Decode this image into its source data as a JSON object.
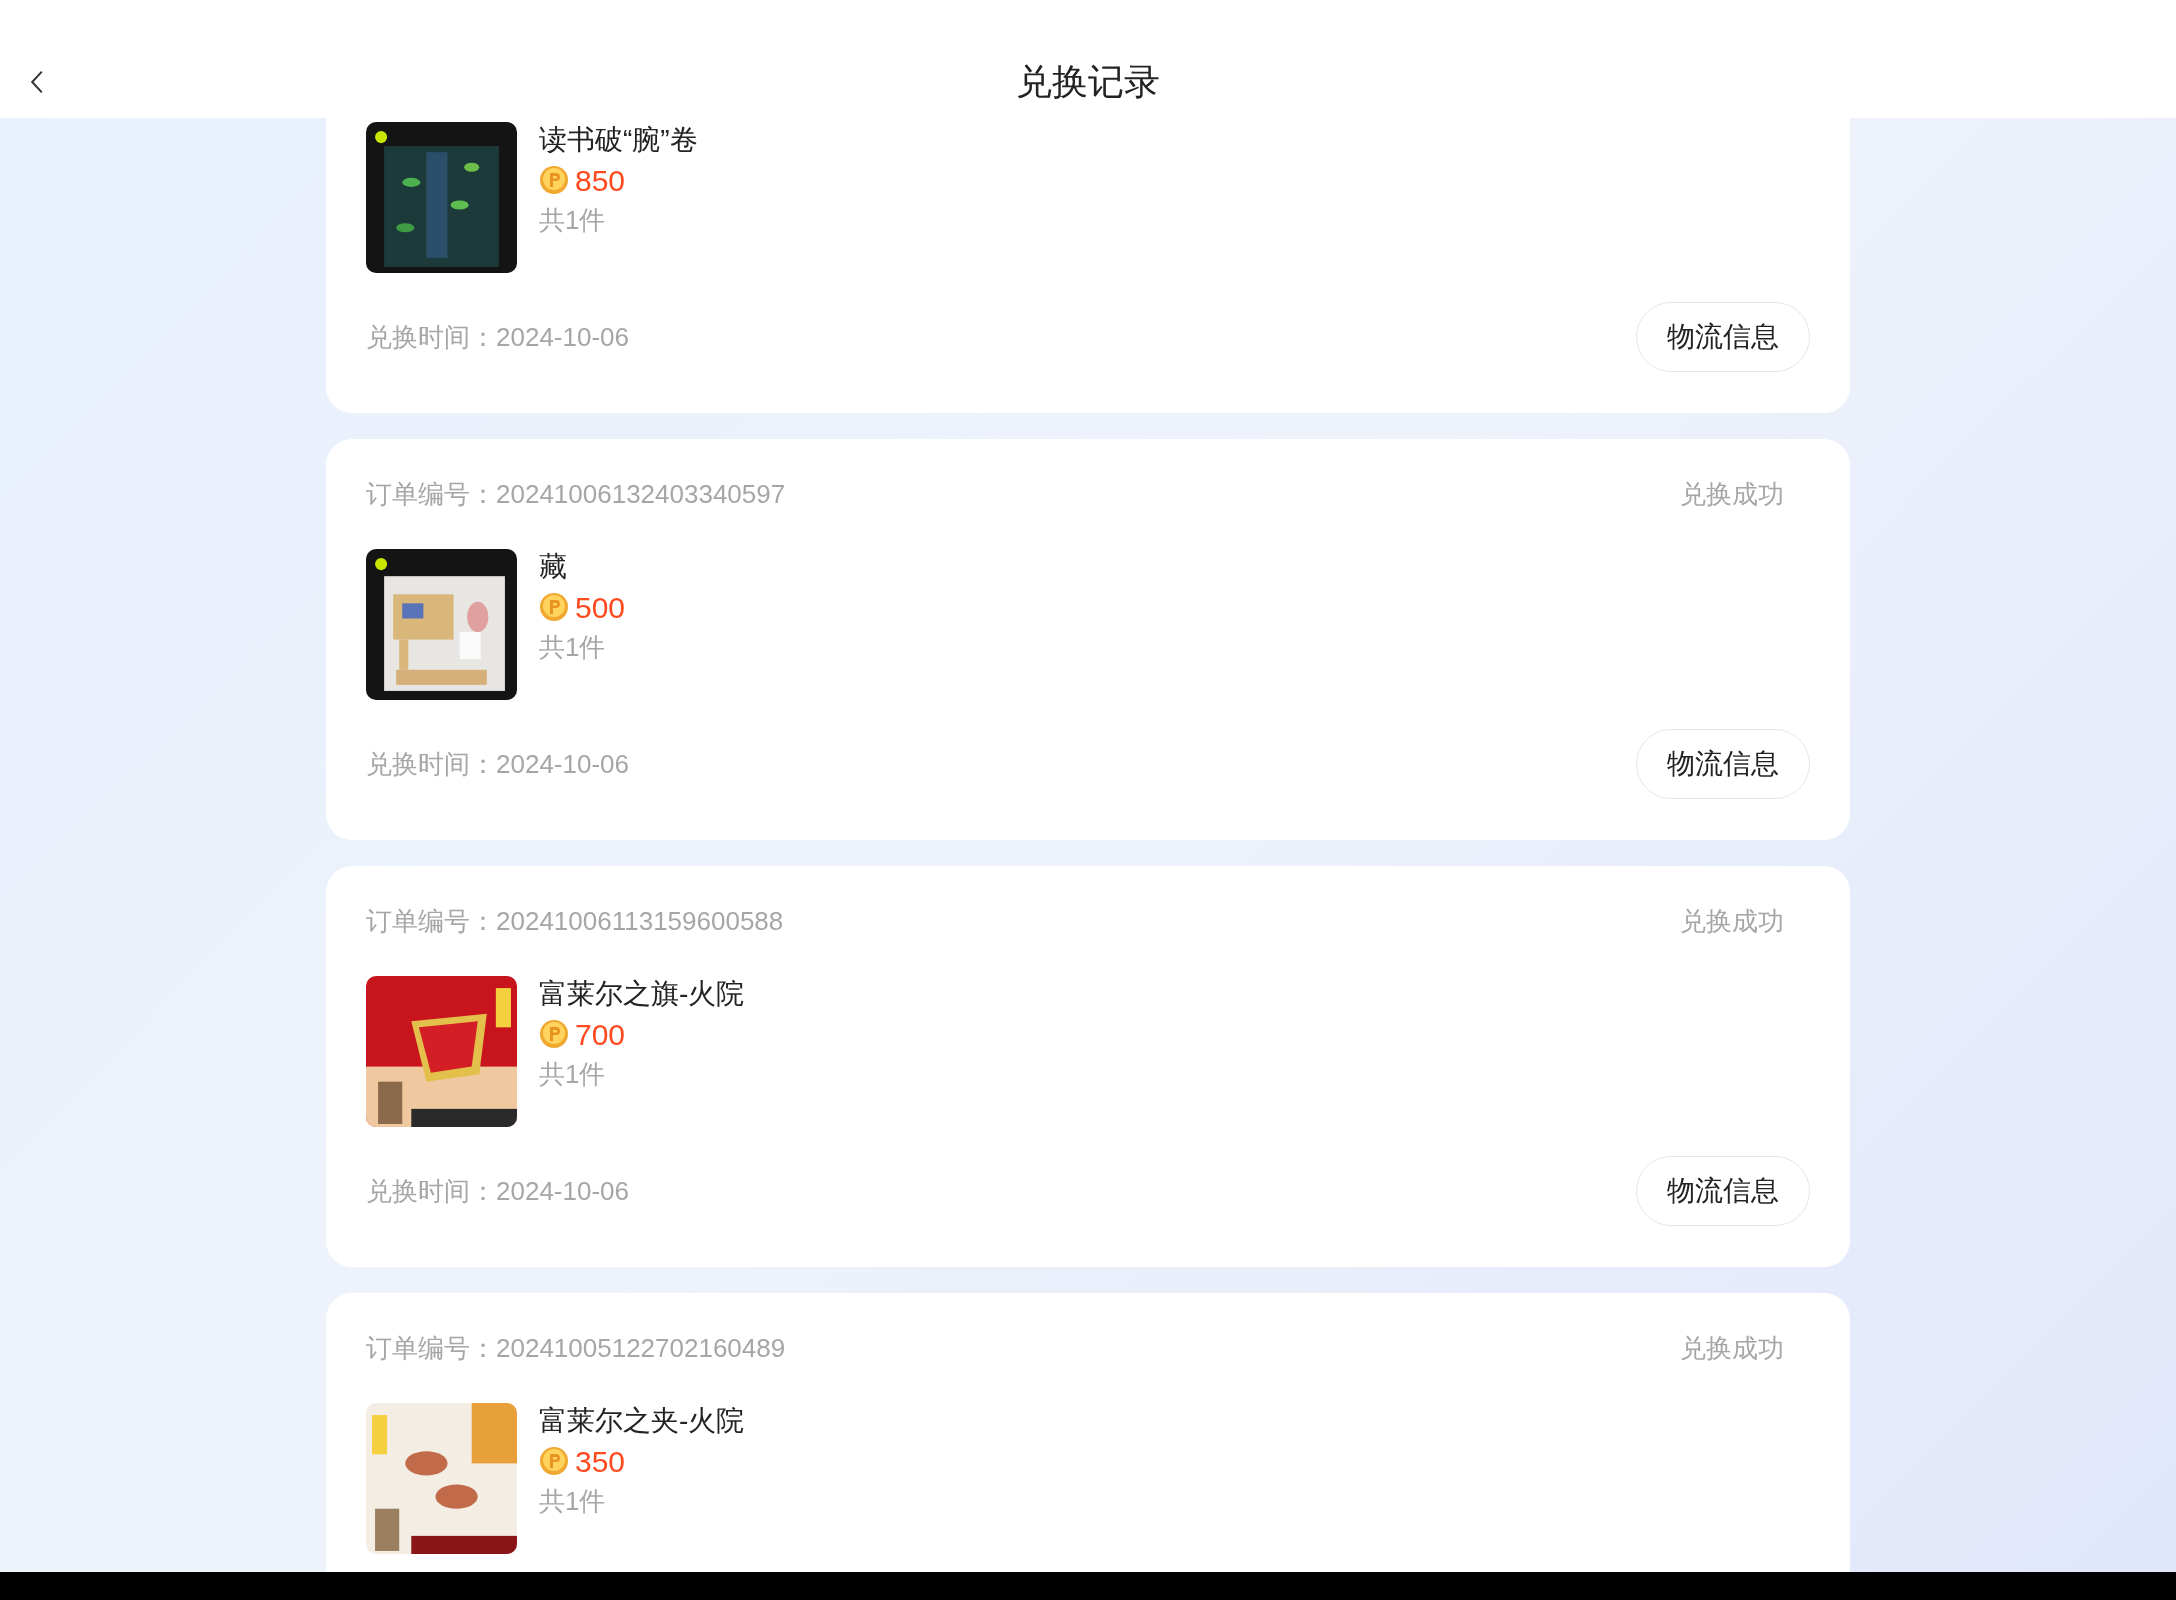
{
  "header": {
    "title": "兑换记录"
  },
  "orders": [
    {
      "name": "读书破“腕”卷",
      "price": "850",
      "count": "共1件",
      "time": "兑换时间：2024-10-06",
      "button": "物流信息"
    },
    {
      "order_no": "订单编号：20241006132403340597",
      "status": "兑换成功",
      "name": "藏",
      "price": "500",
      "count": "共1件",
      "time": "兑换时间：2024-10-06",
      "button": "物流信息"
    },
    {
      "order_no": "订单编号：20241006113159600588",
      "status": "兑换成功",
      "name": "富莱尔之旗-火院",
      "price": "700",
      "count": "共1件",
      "time": "兑换时间：2024-10-06",
      "button": "物流信息"
    },
    {
      "order_no": "订单编号：20241005122702160489",
      "status": "兑换成功",
      "name": "富莱尔之夹-火院",
      "price": "350",
      "count": "共1件"
    }
  ]
}
